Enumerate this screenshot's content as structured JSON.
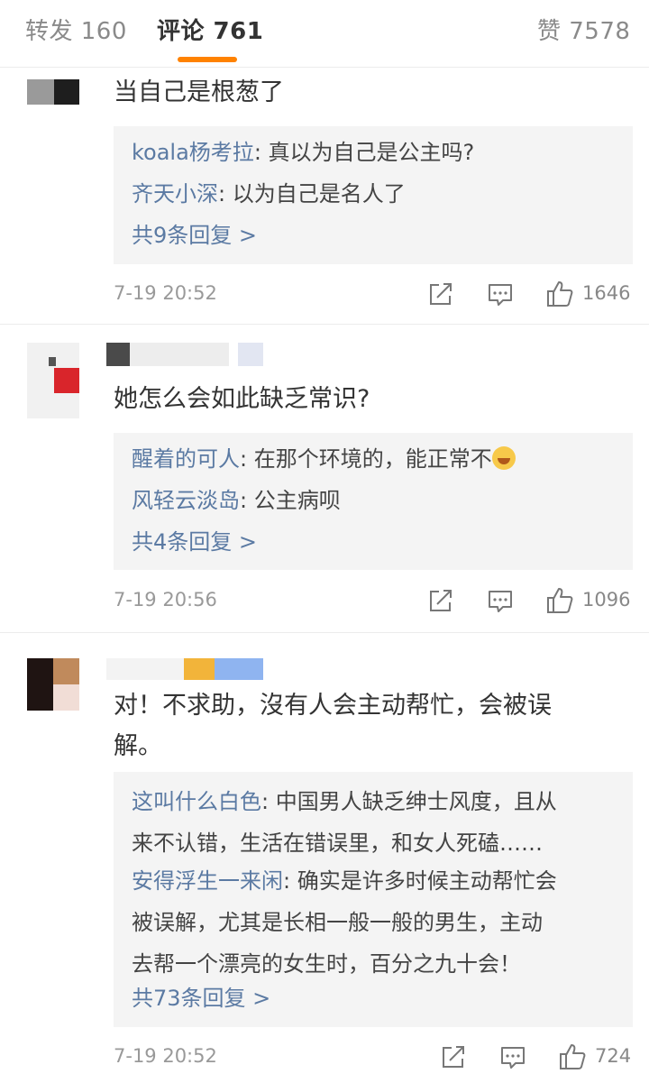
{
  "tabs": {
    "repost_label": "转发 160",
    "comment_label": "评论 761",
    "like_label": "赞 7578"
  },
  "colors": {
    "accent": "#ff8200",
    "username": "#5b7aa3",
    "reply_bg": "#f4f4f4"
  },
  "comments": [
    {
      "text": "当自己是根葱了",
      "replies": [
        {
          "user": "koala杨考拉",
          "text": ": 真以为自己是公主吗?"
        },
        {
          "user": "齐天小深",
          "text": ": 以为自己是名人了"
        }
      ],
      "more": "共9条回复 >",
      "time": "7-19 20:52",
      "likes": "1646"
    },
    {
      "text": "她怎么会如此缺乏常识?",
      "replies": [
        {
          "user": "醒着的可人",
          "text": ": 在那个环境的，能正常不",
          "emoji": "laugh-cry-emoji"
        },
        {
          "user": "风轻云淡岛",
          "text": ": 公主病呗"
        }
      ],
      "more": "共4条回复 >",
      "time": "7-19 20:56",
      "likes": "1096"
    },
    {
      "text_line1": "对！不求助，沒有人会主动帮忙，会被误",
      "text_line2": "解。",
      "replies": [
        {
          "user": "这叫什么白色",
          "text_line1": ": 中国男人缺乏绅士风度，且从",
          "text_line2": "来不认错，生活在错误里，和女人死磕……"
        },
        {
          "user": "安得浮生一来闲",
          "text_line1": ": 确实是许多时候主动帮忙会",
          "text_line2": "被误解，尤其是长相一般一般的男生，主动",
          "text_line3": "去帮一个漂亮的女生时，百分之九十会！"
        }
      ],
      "more": "共73条回复 >",
      "time": "7-19 20:52",
      "likes": "724"
    }
  ],
  "icons": [
    "repost-icon",
    "comment-icon",
    "like-icon"
  ]
}
